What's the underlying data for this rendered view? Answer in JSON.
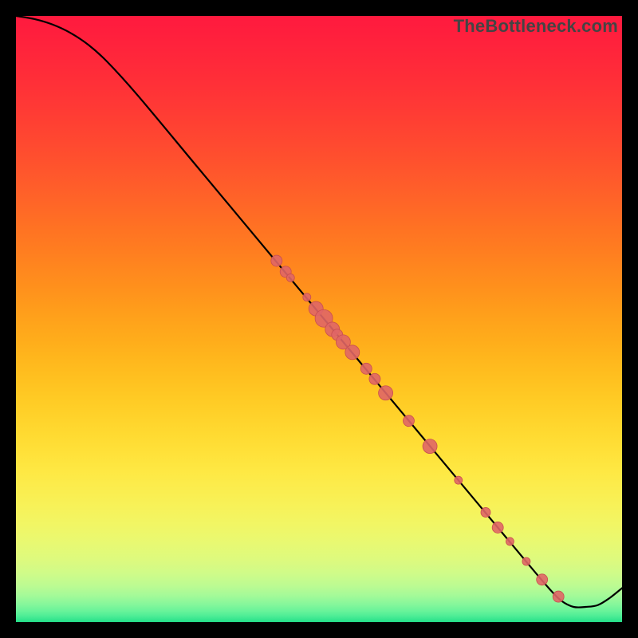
{
  "watermark": "TheBottleneck.com",
  "chart_data": {
    "type": "line",
    "title": "",
    "xlabel": "",
    "ylabel": "",
    "xlim": [
      0,
      100
    ],
    "ylim": [
      0,
      100
    ],
    "grid": false,
    "legend": false,
    "series": [
      {
        "name": "curve",
        "x": [
          0,
          3,
          6,
          9,
          12,
          15,
          20,
          30,
          40,
          50,
          60,
          70,
          80,
          85,
          88,
          90,
          92,
          94,
          96,
          98,
          100
        ],
        "y": [
          100,
          99.5,
          98.6,
          97.2,
          95.2,
          92.5,
          87,
          75,
          63,
          51,
          39,
          27,
          15,
          9,
          5.5,
          3.5,
          2.5,
          2.5,
          2.8,
          4.0,
          5.6
        ]
      }
    ],
    "markers": [
      {
        "x": 43.0,
        "y": 59.6,
        "r": 7
      },
      {
        "x": 44.5,
        "y": 57.8,
        "r": 7
      },
      {
        "x": 45.3,
        "y": 56.8,
        "r": 5
      },
      {
        "x": 48.0,
        "y": 53.6,
        "r": 5
      },
      {
        "x": 49.5,
        "y": 51.7,
        "r": 9
      },
      {
        "x": 50.8,
        "y": 50.1,
        "r": 11
      },
      {
        "x": 52.2,
        "y": 48.3,
        "r": 9
      },
      {
        "x": 53.0,
        "y": 47.4,
        "r": 7
      },
      {
        "x": 54.0,
        "y": 46.2,
        "r": 9
      },
      {
        "x": 55.5,
        "y": 44.5,
        "r": 9
      },
      {
        "x": 57.8,
        "y": 41.8,
        "r": 7
      },
      {
        "x": 59.2,
        "y": 40.1,
        "r": 7
      },
      {
        "x": 61.0,
        "y": 37.8,
        "r": 9
      },
      {
        "x": 64.8,
        "y": 33.2,
        "r": 7
      },
      {
        "x": 68.3,
        "y": 29.0,
        "r": 9
      },
      {
        "x": 73.0,
        "y": 23.4,
        "r": 5
      },
      {
        "x": 77.5,
        "y": 18.1,
        "r": 6
      },
      {
        "x": 79.5,
        "y": 15.6,
        "r": 7
      },
      {
        "x": 81.5,
        "y": 13.3,
        "r": 5
      },
      {
        "x": 84.2,
        "y": 10.0,
        "r": 5
      },
      {
        "x": 86.8,
        "y": 7.0,
        "r": 7
      },
      {
        "x": 89.5,
        "y": 4.2,
        "r": 7
      }
    ],
    "gradient_stops": [
      {
        "offset": 0.0,
        "color": "#ff1a3e"
      },
      {
        "offset": 0.03,
        "color": "#ff1f3d"
      },
      {
        "offset": 0.06,
        "color": "#ff253b"
      },
      {
        "offset": 0.09,
        "color": "#ff2b39"
      },
      {
        "offset": 0.12,
        "color": "#ff3237"
      },
      {
        "offset": 0.15,
        "color": "#ff3935"
      },
      {
        "offset": 0.18,
        "color": "#ff4132"
      },
      {
        "offset": 0.21,
        "color": "#ff4930"
      },
      {
        "offset": 0.24,
        "color": "#ff512d"
      },
      {
        "offset": 0.27,
        "color": "#ff5a2b"
      },
      {
        "offset": 0.3,
        "color": "#ff6328"
      },
      {
        "offset": 0.33,
        "color": "#ff6c25"
      },
      {
        "offset": 0.36,
        "color": "#ff7522"
      },
      {
        "offset": 0.39,
        "color": "#ff7e20"
      },
      {
        "offset": 0.42,
        "color": "#ff881e"
      },
      {
        "offset": 0.45,
        "color": "#ff911c"
      },
      {
        "offset": 0.48,
        "color": "#ff9b1b"
      },
      {
        "offset": 0.51,
        "color": "#ffa51b"
      },
      {
        "offset": 0.54,
        "color": "#ffae1b"
      },
      {
        "offset": 0.57,
        "color": "#ffb81d"
      },
      {
        "offset": 0.6,
        "color": "#ffc120"
      },
      {
        "offset": 0.63,
        "color": "#ffca24"
      },
      {
        "offset": 0.66,
        "color": "#ffd22a"
      },
      {
        "offset": 0.69,
        "color": "#ffda31"
      },
      {
        "offset": 0.72,
        "color": "#ffe139"
      },
      {
        "offset": 0.75,
        "color": "#fee843"
      },
      {
        "offset": 0.78,
        "color": "#fbed4e"
      },
      {
        "offset": 0.81,
        "color": "#f7f259"
      },
      {
        "offset": 0.84,
        "color": "#f1f665"
      },
      {
        "offset": 0.87,
        "color": "#e8f972"
      },
      {
        "offset": 0.9,
        "color": "#dcfa7f"
      },
      {
        "offset": 0.92,
        "color": "#cffb89"
      },
      {
        "offset": 0.94,
        "color": "#bcfb92"
      },
      {
        "offset": 0.955,
        "color": "#a6fa98"
      },
      {
        "offset": 0.97,
        "color": "#87f79b"
      },
      {
        "offset": 0.982,
        "color": "#68f39a"
      },
      {
        "offset": 0.991,
        "color": "#4aec95"
      },
      {
        "offset": 0.997,
        "color": "#31e38d"
      },
      {
        "offset": 1.0,
        "color": "#22db87"
      }
    ],
    "colors": {
      "line": "#000000",
      "marker_fill": "#e06666",
      "marker_stroke": "#c94f4f",
      "background": "#000000"
    }
  }
}
